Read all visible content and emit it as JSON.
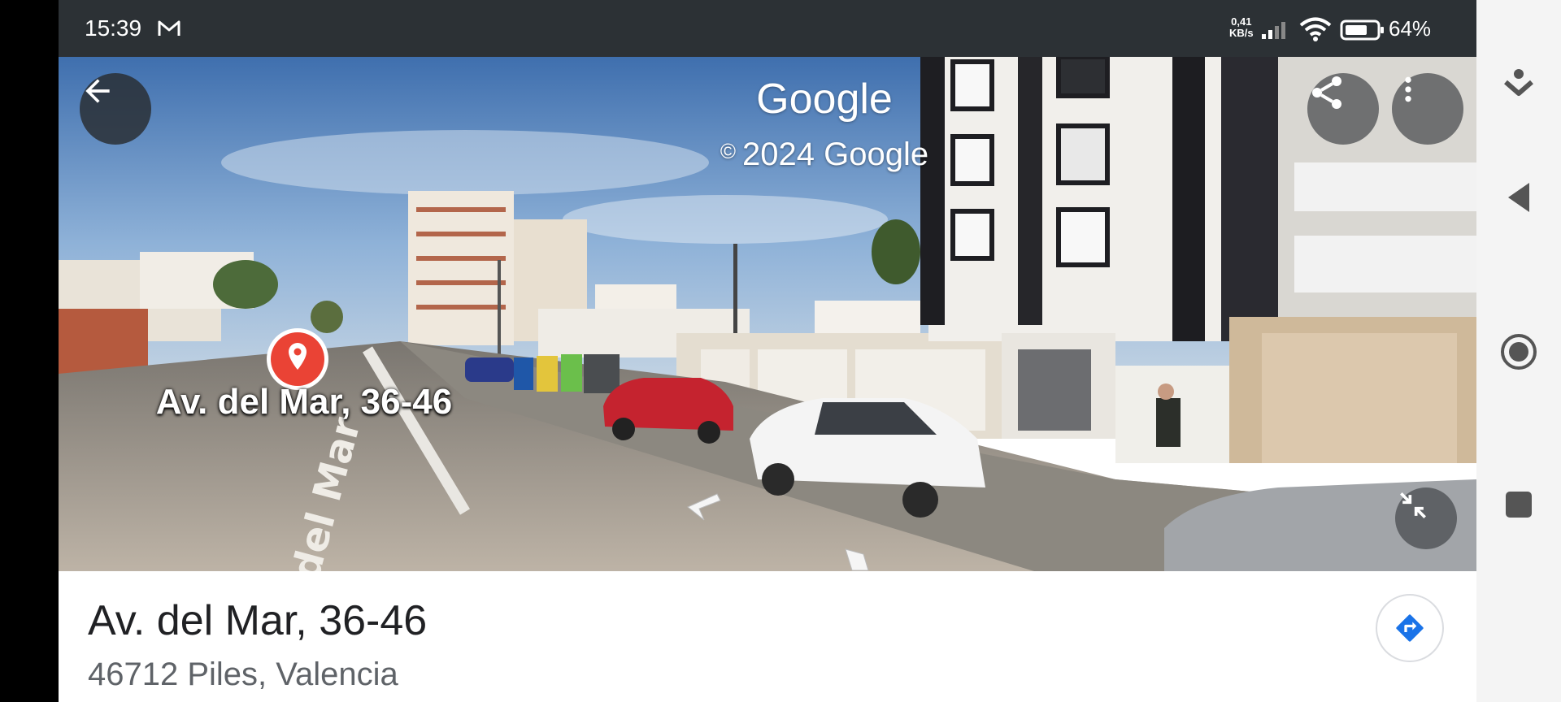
{
  "status_bar": {
    "time": "15:39",
    "network_speed_value": "0,41",
    "network_speed_unit": "KB/s",
    "battery": "64%"
  },
  "street_view": {
    "watermark": "Google",
    "copyright_symbol": "©",
    "copyright_text": "2024 Google",
    "pin_label": "Av. del Mar, 36-46",
    "road_marking": "del Mar"
  },
  "place": {
    "title": "Av. del Mar, 36-46",
    "subtitle": "46712 Piles, Valencia"
  },
  "colors": {
    "pin": "#ea4335",
    "directions": "#1a73e8",
    "status_bar": "#2c3135"
  },
  "icons": {
    "back": "arrow-left-icon",
    "share": "share-icon",
    "more": "more-vert-icon",
    "exit_fullscreen": "exit-fullscreen-icon",
    "directions": "directions-icon",
    "mail": "gmail-icon"
  }
}
